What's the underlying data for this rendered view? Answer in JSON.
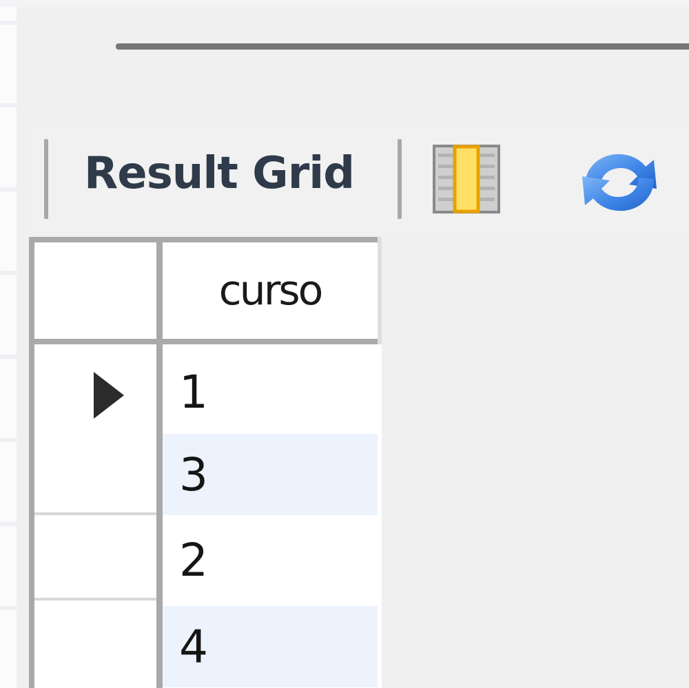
{
  "toolbar": {
    "result_grid_label": "Result Grid",
    "columns_icon": "column-toggle-icon",
    "refresh_icon": "refresh-icon",
    "accent_yellow": "#ffe066",
    "accent_blue": "#3f86e8"
  },
  "grid": {
    "columns": [
      "curso"
    ],
    "rows": [
      {
        "curso": "1",
        "current": true
      },
      {
        "curso": "3",
        "current": false
      },
      {
        "curso": "2",
        "current": false
      },
      {
        "curso": "4",
        "current": false
      }
    ],
    "current_row_icon": "row-pointer-icon",
    "alt_row_color": "#ecf3fd"
  }
}
